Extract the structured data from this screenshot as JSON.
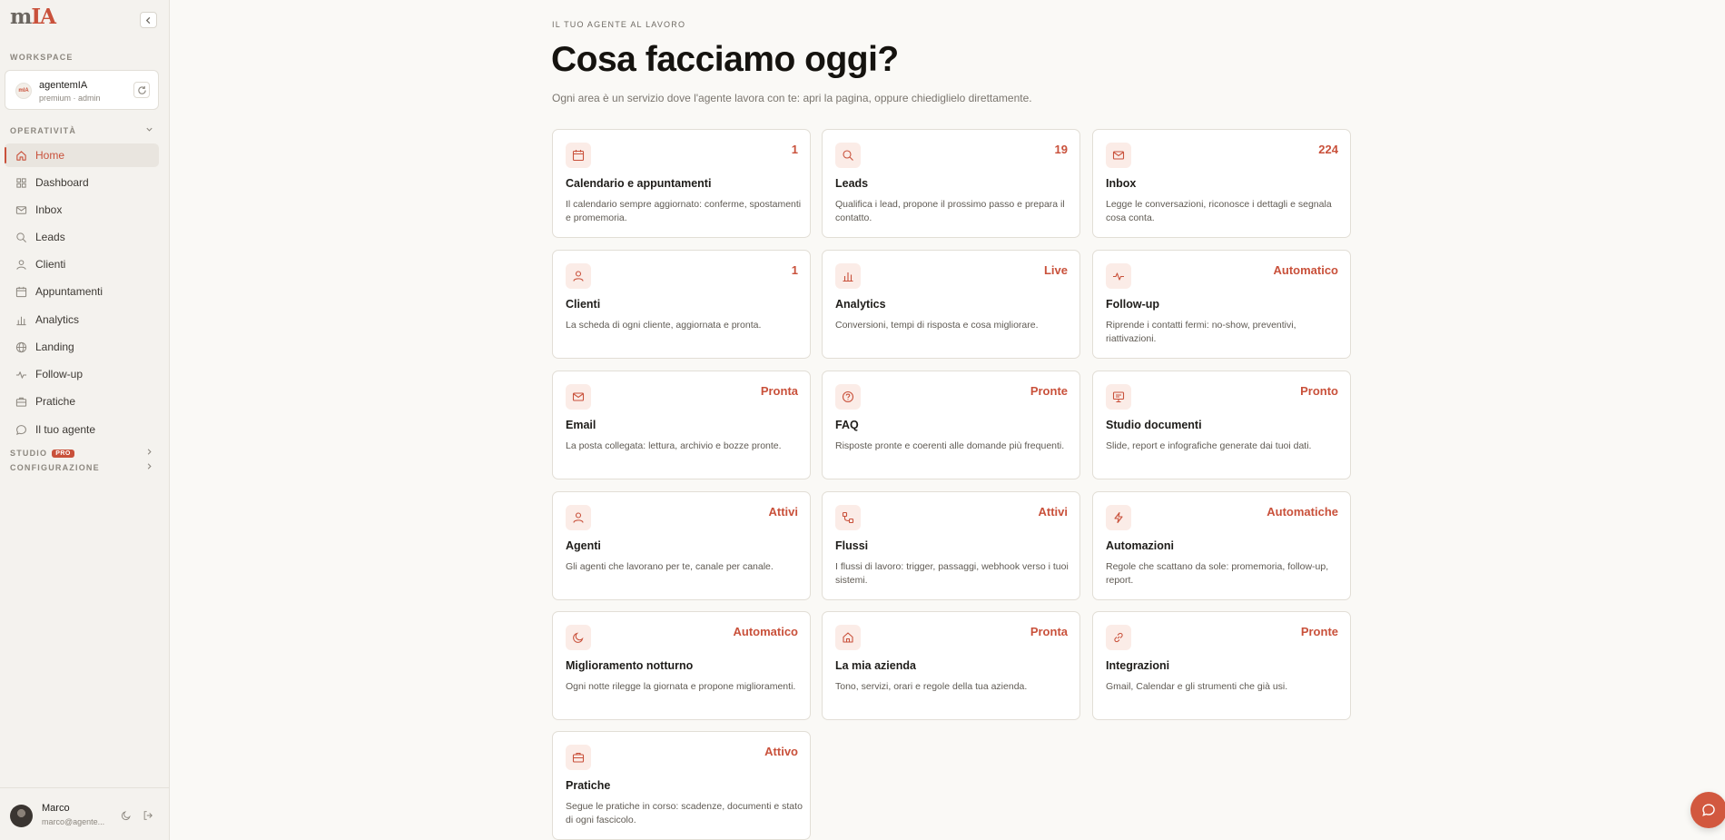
{
  "sidebar": {
    "workspace_label": "WORKSPACE",
    "workspace": {
      "avatar_text": "mIA",
      "name": "agentemIA",
      "sub": "premium · admin"
    },
    "operativita_label": "OPERATIVITÀ",
    "items": [
      {
        "label": "Home",
        "icon": "home-icon",
        "active": true
      },
      {
        "label": "Dashboard",
        "icon": "grid-icon"
      },
      {
        "label": "Inbox",
        "icon": "mail-icon"
      },
      {
        "label": "Leads",
        "icon": "search-icon"
      },
      {
        "label": "Clienti",
        "icon": "user-icon"
      },
      {
        "label": "Appuntamenti",
        "icon": "calendar-icon"
      },
      {
        "label": "Analytics",
        "icon": "bar-chart-icon"
      },
      {
        "label": "Landing",
        "icon": "globe-icon"
      },
      {
        "label": "Follow-up",
        "icon": "activity-icon"
      },
      {
        "label": "Pratiche",
        "icon": "briefcase-icon"
      },
      {
        "label": "Il tuo agente",
        "icon": "chat-icon"
      }
    ],
    "studio_label": "STUDIO",
    "pro_badge": "PRO",
    "config_label": "CONFIGURAZIONE",
    "user": {
      "name": "Marco",
      "email": "marco@agente..."
    }
  },
  "main": {
    "eyebrow": "IL TUO AGENTE AL LAVORO",
    "title": "Cosa facciamo oggi?",
    "subtitle": "Ogni area è un servizio dove l'agente lavora con te: apri la pagina, oppure chiediglielo direttamente.",
    "cards": [
      {
        "title": "Calendario e appuntamenti",
        "badge": "1",
        "icon": "calendar-icon",
        "desc": "Il calendario sempre aggiornato: conferme, spostamenti e promemoria."
      },
      {
        "title": "Leads",
        "badge": "19",
        "icon": "search-icon",
        "desc": "Qualifica i lead, propone il prossimo passo e prepara il contatto."
      },
      {
        "title": "Inbox",
        "badge": "224",
        "icon": "mail-icon",
        "desc": "Legge le conversazioni, riconosce i dettagli e segnala cosa conta."
      },
      {
        "title": "Clienti",
        "badge": "1",
        "icon": "user-icon",
        "desc": "La scheda di ogni cliente, aggiornata e pronta."
      },
      {
        "title": "Analytics",
        "badge": "Live",
        "icon": "bar-chart-icon",
        "desc": "Conversioni, tempi di risposta e cosa migliorare."
      },
      {
        "title": "Follow-up",
        "badge": "Automatico",
        "icon": "activity-icon",
        "desc": "Riprende i contatti fermi: no-show, preventivi, riattivazioni."
      },
      {
        "title": "Email",
        "badge": "Pronta",
        "icon": "mail-icon",
        "desc": "La posta collegata: lettura, archivio e bozze pronte."
      },
      {
        "title": "FAQ",
        "badge": "Pronte",
        "icon": "help-circle-icon",
        "desc": "Risposte pronte e coerenti alle domande più frequenti."
      },
      {
        "title": "Studio documenti",
        "badge": "Pronto",
        "icon": "presentation-icon",
        "desc": "Slide, report e infografiche generate dai tuoi dati."
      },
      {
        "title": "Agenti",
        "badge": "Attivi",
        "icon": "user-icon",
        "desc": "Gli agenti che lavorano per te, canale per canale."
      },
      {
        "title": "Flussi",
        "badge": "Attivi",
        "icon": "workflow-icon",
        "desc": "I flussi di lavoro: trigger, passaggi, webhook verso i tuoi sistemi."
      },
      {
        "title": "Automazioni",
        "badge": "Automatiche",
        "icon": "zap-icon",
        "desc": "Regole che scattano da sole: promemoria, follow-up, report."
      },
      {
        "title": "Miglioramento notturno",
        "badge": "Automatico",
        "icon": "moon-icon",
        "desc": "Ogni notte rilegge la giornata e propone miglioramenti."
      },
      {
        "title": "La mia azienda",
        "badge": "Pronta",
        "icon": "house-icon",
        "desc": "Tono, servizi, orari e regole della tua azienda."
      },
      {
        "title": "Integrazioni",
        "badge": "Pronte",
        "icon": "link-icon",
        "desc": "Gmail, Calendar e gli strumenti che già usi."
      },
      {
        "title": "Pratiche",
        "badge": "Attivo",
        "icon": "briefcase-icon",
        "desc": "Segue le pratiche in corso: scadenze, documenti e stato di ogni fascicolo."
      }
    ]
  },
  "colors": {
    "accent": "#c9513b",
    "accent_soft": "#fbece7",
    "sidebar_bg": "#f4f2ee",
    "page_bg": "#faf9f6"
  }
}
